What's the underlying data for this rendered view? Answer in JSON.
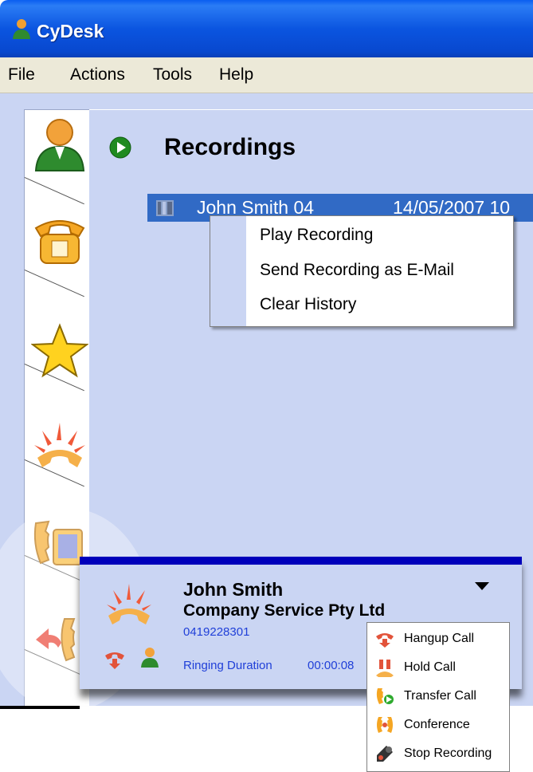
{
  "window": {
    "title": "CyDesk"
  },
  "menubar": {
    "items": [
      "File",
      "Actions",
      "Tools",
      "Help"
    ]
  },
  "sidebar": {
    "items": [
      {
        "icon": "contact-person-icon"
      },
      {
        "icon": "phone-icon"
      },
      {
        "icon": "star-icon"
      },
      {
        "icon": "ringing-phone-icon"
      },
      {
        "icon": "phone-keypad-icon"
      },
      {
        "icon": "return-call-icon"
      }
    ]
  },
  "main": {
    "section_title": "Recordings",
    "recordings": [
      {
        "name": "John Smith 04",
        "date": "14/05/2007 10"
      }
    ]
  },
  "context_menu": {
    "items": [
      "Play Recording",
      "Send Recording as E-Mail",
      "Clear History"
    ]
  },
  "call": {
    "name": "John Smith",
    "company": "Company Service Pty Ltd",
    "phone": "0419228301",
    "ringing_label": "Ringing Duration",
    "ringing_time": "00:00:08"
  },
  "call_menu": {
    "items": [
      {
        "label": "Hangup Call",
        "icon": "hangup-icon"
      },
      {
        "label": "Hold Call",
        "icon": "hold-icon"
      },
      {
        "label": "Transfer Call",
        "icon": "transfer-icon"
      },
      {
        "label": "Conference",
        "icon": "conference-icon"
      },
      {
        "label": "Stop Recording",
        "icon": "stop-recording-icon"
      }
    ]
  },
  "colors": {
    "titlebar": "#0b55e0",
    "client": "#cad5f3",
    "selection": "#316ac5",
    "call_panel_border": "#0000bb",
    "link_blue": "#1f3fd8"
  }
}
